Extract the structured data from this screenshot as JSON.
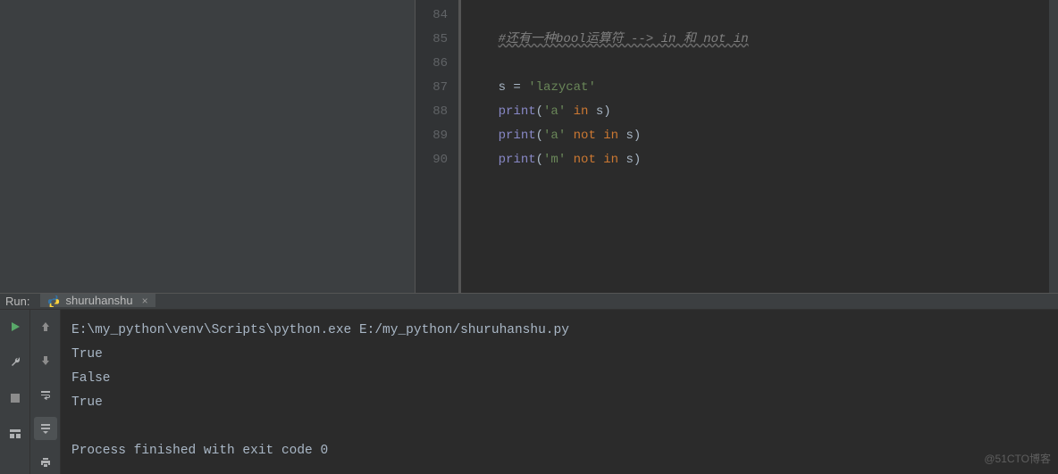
{
  "editor": {
    "lines": [
      {
        "num": "84",
        "tokens": []
      },
      {
        "num": "85",
        "tokens": [
          {
            "cls": "pad",
            "t": "    "
          },
          {
            "cls": "c-comment",
            "t": "#还有一种bool运算符 --> in 和 not in"
          }
        ]
      },
      {
        "num": "86",
        "tokens": []
      },
      {
        "num": "87",
        "tokens": [
          {
            "cls": "pad",
            "t": "    "
          },
          {
            "cls": "c-ident",
            "t": "s "
          },
          {
            "cls": "c-op",
            "t": "= "
          },
          {
            "cls": "c-string",
            "t": "'lazycat'"
          }
        ]
      },
      {
        "num": "88",
        "tokens": [
          {
            "cls": "pad",
            "t": "    "
          },
          {
            "cls": "c-call",
            "t": "print"
          },
          {
            "cls": "c-paren",
            "t": "("
          },
          {
            "cls": "c-string",
            "t": "'a'"
          },
          {
            "cls": "c-ident",
            "t": " "
          },
          {
            "cls": "c-kw",
            "t": "in "
          },
          {
            "cls": "c-ident",
            "t": "s"
          },
          {
            "cls": "c-paren",
            "t": ")"
          }
        ]
      },
      {
        "num": "89",
        "tokens": [
          {
            "cls": "pad",
            "t": "    "
          },
          {
            "cls": "c-call",
            "t": "print"
          },
          {
            "cls": "c-paren",
            "t": "("
          },
          {
            "cls": "c-string",
            "t": "'a'"
          },
          {
            "cls": "c-ident",
            "t": " "
          },
          {
            "cls": "c-kw",
            "t": "not in "
          },
          {
            "cls": "c-ident",
            "t": "s"
          },
          {
            "cls": "c-paren",
            "t": ")"
          }
        ]
      },
      {
        "num": "90",
        "tokens": [
          {
            "cls": "pad",
            "t": "    "
          },
          {
            "cls": "c-call",
            "t": "print"
          },
          {
            "cls": "c-paren",
            "t": "("
          },
          {
            "cls": "c-string",
            "t": "'m'"
          },
          {
            "cls": "c-ident",
            "t": " "
          },
          {
            "cls": "c-kw",
            "t": "not in "
          },
          {
            "cls": "c-ident",
            "t": "s"
          },
          {
            "cls": "c-paren",
            "t": ")"
          }
        ]
      }
    ]
  },
  "run": {
    "label": "Run:",
    "tab_name": "shuruhanshu",
    "output_lines": [
      "E:\\my_python\\venv\\Scripts\\python.exe E:/my_python/shuruhanshu.py",
      "True",
      "False",
      "True",
      "",
      "Process finished with exit code 0"
    ]
  },
  "watermark": "@51CTO博客"
}
